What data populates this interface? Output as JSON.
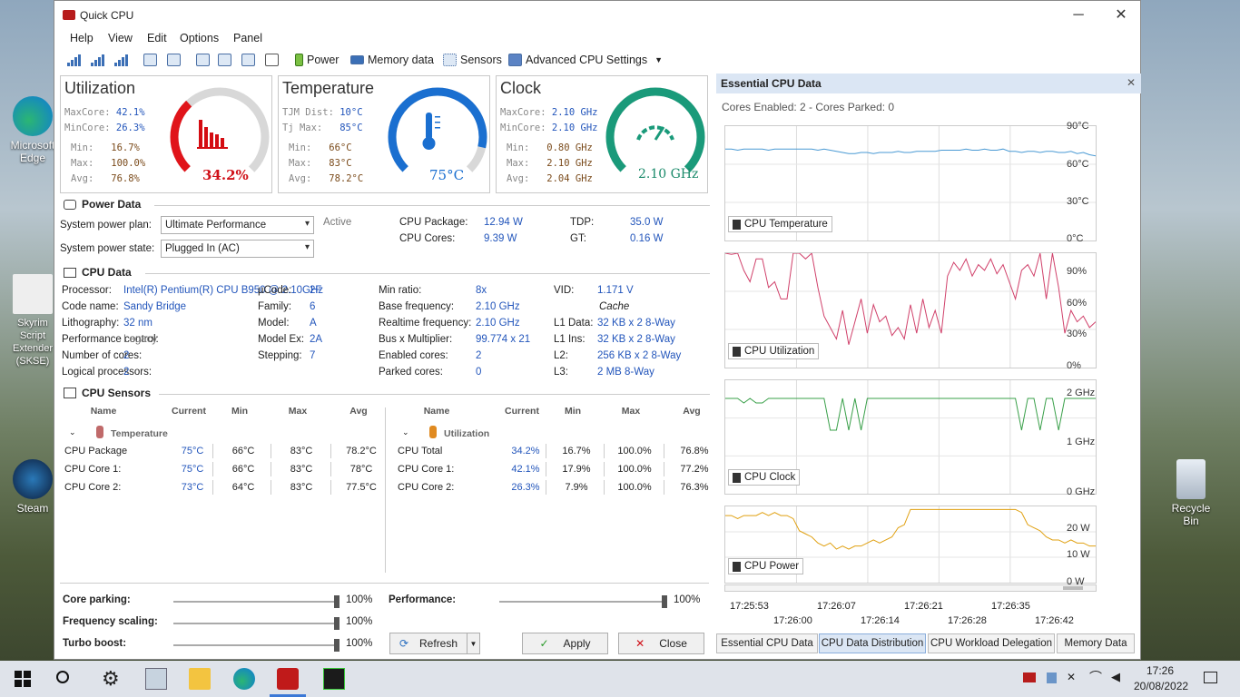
{
  "desktop": {
    "icons": [
      {
        "label": "Microsoft Edge"
      },
      {
        "label": "Skyrim Script Extender (SKSE)"
      },
      {
        "label": "Steam"
      },
      {
        "label": "Recycle Bin"
      }
    ]
  },
  "window": {
    "title": "Quick CPU",
    "minimize": "─",
    "close": "✕"
  },
  "menu": [
    "Help",
    "View",
    "Edit",
    "Options",
    "Panel"
  ],
  "toolbar": {
    "power": "Power",
    "memory": "Memory data",
    "sensors": "Sensors",
    "advanced": "Advanced CPU Settings"
  },
  "utilization": {
    "title": "Utilization",
    "maxcore_l": "MaxCore:",
    "maxcore": "42.1%",
    "mincore_l": "MinCore:",
    "mincore": "26.3%",
    "min_l": "Min:",
    "min": "16.7%",
    "max_l": "Max:",
    "max": "100.0%",
    "avg_l": "Avg:",
    "avg": "76.8%",
    "value": "34.2%",
    "level": 0.342
  },
  "temperature": {
    "title": "Temperature",
    "tjm_l": "TJM Dist:",
    "tjm": "10°C",
    "tj_l": "Tj Max:",
    "tj": "85°C",
    "min_l": "Min:",
    "min": "66°C",
    "max_l": "Max:",
    "max": "83°C",
    "avg_l": "Avg:",
    "avg": "78.2°C",
    "value": "75°C",
    "level": 0.88
  },
  "clock": {
    "title": "Clock",
    "maxcore_l": "MaxCore:",
    "maxcore": "2.10 GHz",
    "mincore_l": "MinCore:",
    "mincore": "2.10 GHz",
    "min_l": "Min:",
    "min": "0.80 GHz",
    "max_l": "Max:",
    "max": "2.10 GHz",
    "avg_l": "Avg:",
    "avg": "2.04 GHz",
    "value": "2.10 GHz",
    "level": 1.0
  },
  "power": {
    "section": "Power Data",
    "plan_l": "System power plan:",
    "plan": "Ultimate Performance",
    "active": "Active",
    "state_l": "System power state:",
    "state": "Plugged In (AC)",
    "pkg_l": "CPU Package:",
    "pkg": "12.94 W",
    "cores_l": "CPU Cores:",
    "cores": "9.39 W",
    "tdp_l": "TDP:",
    "tdp": "35.0 W",
    "gt_l": "GT:",
    "gt": "0.16 W"
  },
  "cpu": {
    "section": "CPU Data",
    "col1": [
      [
        "Processor:",
        "Intel(R) Pentium(R) CPU B950 @ 2.10GHz"
      ],
      [
        "Code name:",
        "Sandy Bridge"
      ],
      [
        "Lithography:",
        "32 nm"
      ],
      [
        "Performance control:",
        "Legacy"
      ],
      [
        "Number of cores:",
        "2"
      ],
      [
        "Logical processors:",
        "2"
      ]
    ],
    "col2": [
      [
        "µCode:",
        "2F"
      ],
      [
        "Family:",
        "6"
      ],
      [
        "Model:",
        "A"
      ],
      [
        "Model Ex:",
        "2A"
      ],
      [
        "Stepping:",
        "7"
      ]
    ],
    "col3": [
      [
        "Min ratio:",
        "8x"
      ],
      [
        "Base frequency:",
        "2.10 GHz"
      ],
      [
        "Realtime frequency:",
        "2.10 GHz"
      ],
      [
        "Bus x Multiplier:",
        "99.774 x 21"
      ],
      [
        "Enabled cores:",
        "2"
      ],
      [
        "Parked cores:",
        "0"
      ]
    ],
    "col4": [
      [
        "VID:",
        "1.171 V"
      ],
      [
        "",
        "Cache"
      ],
      [
        "L1 Data:",
        "32 KB x 2  8-Way"
      ],
      [
        "L1 Ins:",
        "32 KB x 2  8-Way"
      ],
      [
        "L2:",
        "256 KB x 2  8-Way"
      ],
      [
        "L3:",
        "2 MB  8-Way"
      ]
    ]
  },
  "sensors": {
    "section": "CPU Sensors",
    "headers": [
      "Name",
      "Current",
      "Min",
      "Max",
      "Avg"
    ],
    "temp_group": "Temperature",
    "temp_rows": [
      [
        "CPU Package",
        "75°C",
        "66°C",
        "83°C",
        "78.2°C"
      ],
      [
        "CPU Core 1:",
        "75°C",
        "66°C",
        "83°C",
        "78°C"
      ],
      [
        "CPU Core 2:",
        "73°C",
        "64°C",
        "83°C",
        "77.5°C"
      ]
    ],
    "util_group": "Utilization",
    "util_rows": [
      [
        "CPU Total",
        "34.2%",
        "16.7%",
        "100.0%",
        "76.8%"
      ],
      [
        "CPU Core 1:",
        "42.1%",
        "17.9%",
        "100.0%",
        "77.2%"
      ],
      [
        "CPU Core 2:",
        "26.3%",
        "7.9%",
        "100.0%",
        "76.3%"
      ]
    ]
  },
  "controls": {
    "parking_l": "Core parking:",
    "parking": "100%",
    "parking_v": 1.0,
    "freq_l": "Frequency scaling:",
    "freq": "100%",
    "freq_v": 1.0,
    "turbo_l": "Turbo boost:",
    "turbo": "100%",
    "turbo_v": 1.0,
    "perf_l": "Performance:",
    "perf": "100%",
    "perf_v": 1.0,
    "refresh": "Refresh",
    "apply": "Apply",
    "close": "Close"
  },
  "right": {
    "title": "Essential CPU Data",
    "cores": "Cores Enabled: 2 - Cores Parked: 0",
    "temp_label": "CPU Temperature",
    "temp_y": [
      "90°C",
      "60°C",
      "30°C",
      "0°C"
    ],
    "util_label": "CPU Utilization",
    "util_y": [
      "90%",
      "60%",
      "30%",
      "0%"
    ],
    "clock_label": "CPU Clock",
    "clock_y": [
      "2 GHz",
      "1 GHz",
      "0 GHz"
    ],
    "power_label": "CPU Power",
    "power_y": [
      "20 W",
      "10 W",
      "0 W"
    ],
    "x_top": [
      "17:25:53",
      "17:26:07",
      "17:26:21",
      "17:26:35"
    ],
    "x_bottom": [
      "17:26:00",
      "17:26:14",
      "17:26:28",
      "17:26:42"
    ],
    "tabs": [
      "Essential CPU Data",
      "CPU Data Distribution",
      "CPU Workload Delegation",
      "Memory Data"
    ]
  },
  "chart_data": [
    {
      "type": "line",
      "title": "CPU Temperature",
      "ylim": [
        0,
        100
      ],
      "series": [
        {
          "name": "CPU Temperature",
          "values": [
            80,
            80,
            79,
            80,
            80,
            80,
            80,
            79,
            80,
            80,
            80,
            80,
            80,
            80,
            80,
            79,
            80,
            79,
            78,
            77,
            76,
            76,
            77,
            77,
            76,
            77,
            77,
            77,
            78,
            77,
            77,
            78,
            78,
            78,
            78,
            79,
            79,
            79,
            79,
            80,
            79,
            79,
            80,
            79,
            79,
            80,
            78,
            78,
            77,
            78,
            78,
            77,
            78,
            78,
            77,
            77,
            78,
            76,
            77,
            75,
            74
          ]
        }
      ]
    },
    {
      "type": "line",
      "title": "CPU Utilization",
      "ylim": [
        0,
        100
      ],
      "series": [
        {
          "name": "CPU Utilization",
          "values": [
            100,
            99,
            100,
            85,
            75,
            95,
            95,
            70,
            75,
            60,
            60,
            100,
            100,
            95,
            100,
            70,
            45,
            35,
            25,
            50,
            20,
            40,
            60,
            30,
            55,
            40,
            45,
            28,
            35,
            25,
            55,
            30,
            60,
            35,
            50,
            30,
            80,
            92,
            85,
            95,
            80,
            90,
            85,
            95,
            82,
            90,
            75,
            60,
            85,
            90,
            80,
            100,
            60,
            100,
            70,
            30,
            50,
            40,
            45,
            35,
            40
          ]
        }
      ]
    },
    {
      "type": "line",
      "title": "CPU Clock",
      "ylim": [
        0,
        2.5
      ],
      "series": [
        {
          "name": "CPU Clock",
          "values": [
            2.1,
            2.1,
            2.1,
            2.0,
            2.1,
            2.0,
            2.0,
            2.1,
            2.1,
            2.1,
            2.1,
            2.1,
            2.1,
            2.1,
            2.1,
            2.1,
            2.1,
            1.4,
            1.4,
            2.1,
            1.4,
            2.1,
            1.4,
            2.1,
            2.1,
            2.1,
            2.1,
            2.1,
            2.1,
            2.1,
            2.1,
            2.1,
            2.1,
            2.1,
            2.1,
            2.1,
            2.1,
            2.1,
            2.1,
            2.1,
            2.1,
            2.1,
            2.1,
            2.1,
            2.1,
            2.1,
            2.1,
            2.1,
            1.4,
            2.1,
            2.1,
            1.4,
            2.1,
            2.1,
            1.4,
            2.1,
            2.1,
            2.1,
            2.1,
            2.1,
            2.1
          ]
        }
      ]
    },
    {
      "type": "line",
      "title": "CPU Power",
      "ylim": [
        0,
        25
      ],
      "series": [
        {
          "name": "CPU Power",
          "values": [
            22,
            22,
            21,
            22,
            22,
            22,
            23,
            22,
            23,
            22,
            22,
            21,
            17,
            16,
            15,
            13,
            12,
            13,
            11,
            12,
            11,
            12,
            12,
            13,
            14,
            13,
            14,
            15,
            18,
            19,
            24,
            24,
            24,
            24,
            24,
            24,
            24,
            24,
            24,
            24,
            24,
            24,
            24,
            24,
            24,
            24,
            24,
            24,
            23,
            19,
            18,
            17,
            15,
            14,
            14,
            13,
            14,
            13,
            13,
            12,
            12
          ]
        }
      ]
    }
  ],
  "taskbar": {
    "time": "17:26",
    "date": "20/08/2022"
  }
}
